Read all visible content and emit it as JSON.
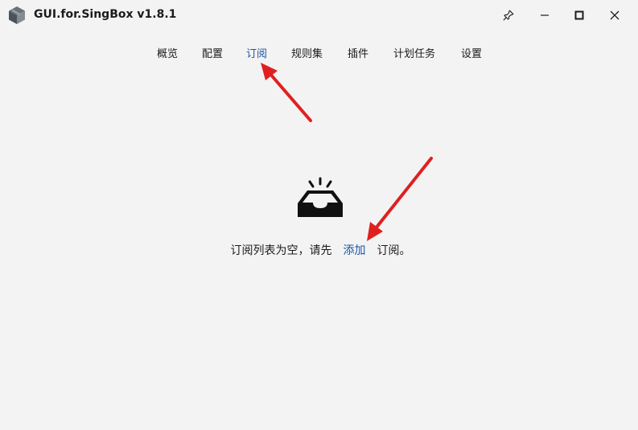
{
  "app": {
    "title": "GUI.for.SingBox v1.8.1",
    "icon": "box-logo-icon"
  },
  "titlebar_buttons": {
    "pin": "pin-icon",
    "minimize": "minimize-icon",
    "maximize": "maximize-icon",
    "close": "close-icon"
  },
  "nav": {
    "items": [
      {
        "label": "概览"
      },
      {
        "label": "配置"
      },
      {
        "label": "订阅",
        "active": true
      },
      {
        "label": "规则集"
      },
      {
        "label": "插件"
      },
      {
        "label": "计划任务"
      },
      {
        "label": "设置"
      }
    ]
  },
  "empty_state": {
    "icon": "inbox-empty-icon",
    "prefix": "订阅列表为空，请先",
    "link": "添加",
    "suffix": "订阅。"
  },
  "colors": {
    "background": "#f3f3f3",
    "accent": "#1a56a6",
    "annotation_arrow": "#e02020"
  }
}
